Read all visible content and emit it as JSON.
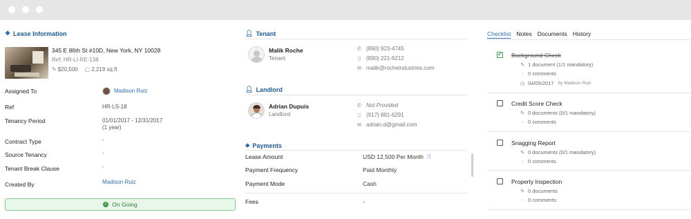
{
  "lease": {
    "section_title": "Lease Information",
    "address": "345 E 86th St #10D, New York, NY 10028",
    "ref_line": "Ref: HR-LI-RE-138",
    "price": "$20,500",
    "area": "2,219 sq.ft",
    "fields": [
      {
        "label": "Assigned To",
        "value": "Madison Ruiz"
      },
      {
        "label": "Ref",
        "value": "HR-LS-18"
      },
      {
        "label": "Tenancy Period",
        "value": "01/01/2017 - 12/31/2017",
        "value2": "(1 year)"
      },
      {
        "label": "Contract Type",
        "value": "-"
      },
      {
        "label": "Source Tenancy",
        "value": "-"
      },
      {
        "label": "Tenant Break Clause",
        "value": "-"
      },
      {
        "label": "Created By",
        "value": "Madison Ruiz"
      }
    ],
    "status": "On Going"
  },
  "tenant": {
    "section_title": "Tenant",
    "name": "Malik Roche",
    "role": "Tenant",
    "phone": "(890) 923-4745",
    "mobile": "(890) 221-6212",
    "email": "malik@rocheindustries.com"
  },
  "landlord": {
    "section_title": "Landlord",
    "name": "Adrian Dupuis",
    "role": "Landlord",
    "phone": "Not Provided",
    "mobile": "(917) 881-6291",
    "email": "adrian.d@gmail.com"
  },
  "payments": {
    "section_title": "Payments",
    "rows": [
      {
        "label": "Lease Amount",
        "value": "USD 12,500 Per Month"
      },
      {
        "label": "Payment Frequency",
        "value": "Paid Monthly"
      },
      {
        "label": "Payment Mode",
        "value": "Cash"
      },
      {
        "label": "Fees",
        "value": "-"
      }
    ]
  },
  "tabs": [
    "Checklist",
    "Notes",
    "Documents",
    "History"
  ],
  "checklist": [
    {
      "title": "Background Check",
      "docs": "1 document (1/1 mandatory)",
      "comments": "0 comments",
      "date": "04/05/2017",
      "by": "by Madison Ruiz",
      "done": true
    },
    {
      "title": "Credit Score Check",
      "docs": "0 documents (0/1 mandatory)",
      "comments": "0 comments",
      "done": false
    },
    {
      "title": "Snagging Report",
      "docs": "0 documents (0/1 mandatory)",
      "comments": "0 comments",
      "done": false
    },
    {
      "title": "Property Inspection",
      "docs": "0 documents",
      "comments": "0 comments",
      "done": false
    }
  ],
  "colors": {
    "accent": "#2d6fb3",
    "status_bg": "#e9f7ea",
    "status_border": "#83c98a",
    "check": "#3ea24a"
  }
}
